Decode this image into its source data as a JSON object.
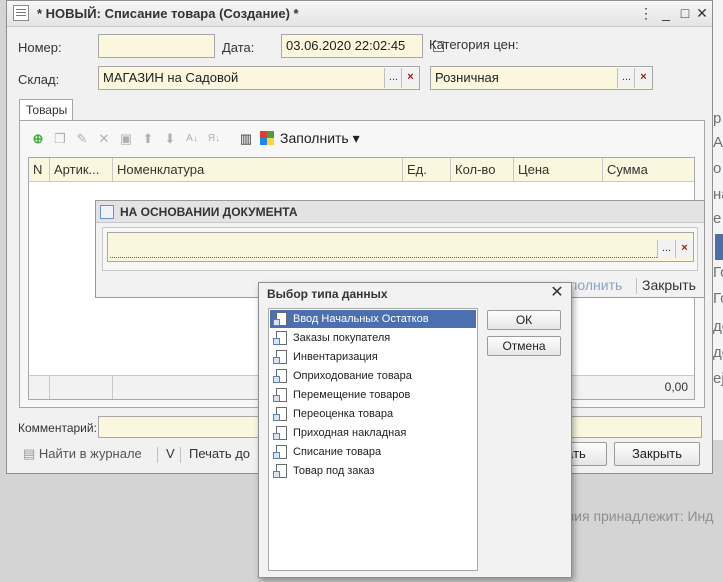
{
  "window": {
    "title": "* НОВЫЙ: Списание товара (Создание) *",
    "buttons": [
      "⋮",
      "_",
      "□",
      "✕"
    ]
  },
  "header": {
    "number_label": "Номер:",
    "number_value": "",
    "date_label": "Дата:",
    "date_value": "03.06.2020 22:02:45",
    "price_category_label": "Категория цен:",
    "warehouse_label": "Склад:",
    "warehouse_value": "МАГАЗИН на Садовой",
    "price_category_value": "Розничная",
    "select_button": "...",
    "clear_button": "×"
  },
  "tabs": [
    {
      "label": "Товары"
    }
  ],
  "toolbar": {
    "icons": [
      "add-icon",
      "copy-icon",
      "edit-icon",
      "delete-icon",
      "save-icon",
      "move-up-icon",
      "move-down-icon",
      "sort-asc-icon",
      "sort-desc-icon",
      "barcode-icon"
    ],
    "fill_label": "Заполнить ▾"
  },
  "table": {
    "columns": [
      "N",
      "Артик...",
      "Номенклатура",
      "Ед.",
      "Кол-во",
      "Цена",
      "Сумма"
    ],
    "total": "0,00"
  },
  "comment_label": "Комментарий:",
  "bottom_links": {
    "journal": "Найти в журнале",
    "v": "V",
    "print": "Печать до"
  },
  "bottom_buttons": {
    "ok_partial": "ать",
    "close": "Закрыть"
  },
  "basis_panel": {
    "title": "НА ОСНОВАНИИ ДОКУМЕНТА",
    "fill_partial": "аполнить",
    "close": "Закрыть"
  },
  "dialog": {
    "title": "Выбор типа данных",
    "ok": "ОК",
    "cancel": "Отмена",
    "items": [
      "Ввод Начальных Остатков",
      "Заказы покупателя",
      "Инвентаризация",
      "Оприходование товара",
      "Перемещение товаров",
      "Переоценка товара",
      "Приходная накладная",
      "Списание товара",
      "Товар под заказ"
    ],
    "selected_index": 0
  },
  "background": {
    "status_text": "нзия принадлежит: Инд",
    "letters": [
      "р",
      "А",
      "о",
      "на",
      "е",
      "Т",
      "Го",
      "Го",
      "до",
      "до",
      "еј"
    ]
  }
}
